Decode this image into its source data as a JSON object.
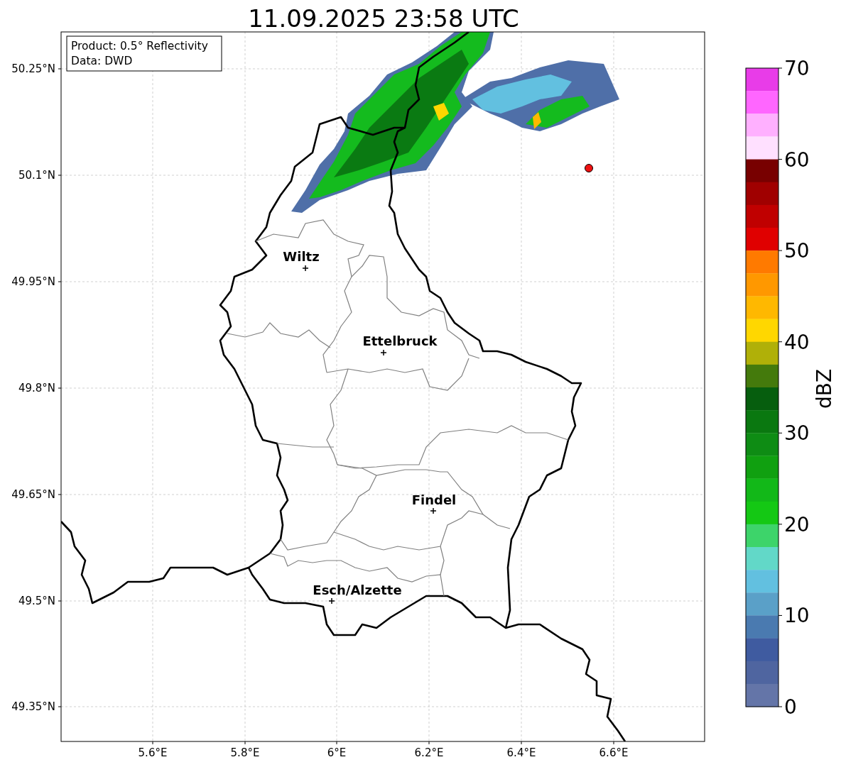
{
  "title": "11.09.2025 23:58 UTC",
  "info_box": [
    "Product: 0.5° Reflectivity",
    "Data: DWD"
  ],
  "map": {
    "lat_ticks": [
      "50.25°N",
      "50.1°N",
      "49.95°N",
      "49.8°N",
      "49.65°N",
      "49.5°N",
      "49.35°N"
    ],
    "lon_ticks": [
      "5.6°E",
      "5.8°E",
      "6°E",
      "6.2°E",
      "6.4°E",
      "6.6°E"
    ],
    "cities": [
      {
        "name": "Wiltz",
        "kind": "town"
      },
      {
        "name": "Ettelbruck",
        "kind": "town"
      },
      {
        "name": "Findel",
        "kind": "town"
      },
      {
        "name": "Esch/Alzette",
        "kind": "town"
      }
    ],
    "radar_site": {
      "color": "#ee1111"
    }
  },
  "colorbar": {
    "label": "dBZ",
    "ticks": [
      "70",
      "60",
      "50",
      "40",
      "30",
      "20",
      "10",
      "0"
    ],
    "bins": [
      {
        "color": "#e83ce8"
      },
      {
        "color": "#ff66ff"
      },
      {
        "color": "#ffb0ff"
      },
      {
        "color": "#ffe0ff"
      },
      {
        "color": "#780000"
      },
      {
        "color": "#a00000"
      },
      {
        "color": "#c00000"
      },
      {
        "color": "#e00000"
      },
      {
        "color": "#ff7a00"
      },
      {
        "color": "#ff9800"
      },
      {
        "color": "#ffb800"
      },
      {
        "color": "#ffd700"
      },
      {
        "color": "#b0b008"
      },
      {
        "color": "#447a0c"
      },
      {
        "color": "#065e0e"
      },
      {
        "color": "#0a7810"
      },
      {
        "color": "#0e8c14"
      },
      {
        "color": "#10a010"
      },
      {
        "color": "#12b818"
      },
      {
        "color": "#14c814"
      },
      {
        "color": "#3dd46a"
      },
      {
        "color": "#62d8c8"
      },
      {
        "color": "#62c0e0"
      },
      {
        "color": "#5aa0c8"
      },
      {
        "color": "#4a7ab0"
      },
      {
        "color": "#3f5ba0"
      },
      {
        "color": "#4f65a0"
      },
      {
        "color": "#6475a8"
      }
    ]
  }
}
